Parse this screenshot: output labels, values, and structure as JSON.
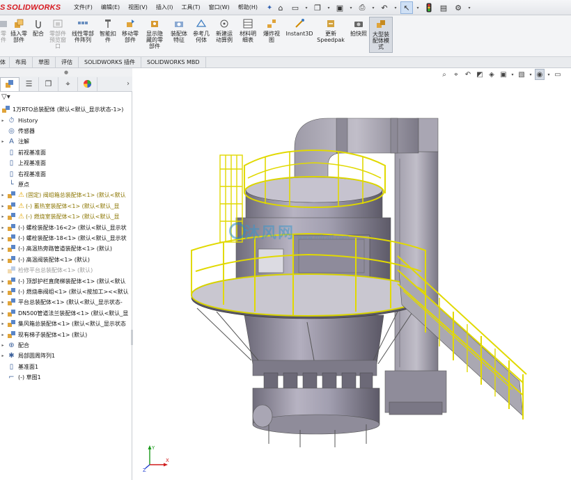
{
  "app": {
    "logo_text": "SOLIDWORKS",
    "menus": [
      "文件(F)",
      "编辑(E)",
      "视图(V)",
      "插入(I)",
      "工具(T)",
      "窗口(W)",
      "帮助(H)"
    ]
  },
  "ribbon": {
    "buttons": [
      {
        "label": "零\n件",
        "dim": true
      },
      {
        "label": "插入零\n部件"
      },
      {
        "label": "配合"
      },
      {
        "label": "零部件\n预览窗\n口",
        "dim": true
      },
      {
        "label": "线性零部\n件阵列"
      },
      {
        "label": "智能扣\n件"
      },
      {
        "label": "移动零\n部件"
      },
      {
        "label": "显示隐\n藏的零\n部件"
      },
      {
        "label": "装配体\n特征"
      },
      {
        "label": "参考几\n何体"
      },
      {
        "label": "新建运\n动算例"
      },
      {
        "label": "材料明\n细表"
      },
      {
        "label": "爆炸视\n图"
      },
      {
        "label": "Instant3D"
      },
      {
        "label": "更新\nSpeedpak"
      },
      {
        "label": "拍快照"
      },
      {
        "label": "大型装\n配体模\n式",
        "active": true
      }
    ]
  },
  "command_tabs": [
    "体",
    "布局",
    "草图",
    "评估",
    "SOLIDWORKS 插件",
    "SOLIDWORKS MBD"
  ],
  "feature_tree": {
    "root": "1万RTO总装配体  (默认<默认_显示状态-1>)",
    "items": [
      {
        "label": "History",
        "icon": "history-icon",
        "toggle": true
      },
      {
        "label": "传感器",
        "icon": "sensor-icon",
        "toggle": false
      },
      {
        "label": "注解",
        "icon": "annotation-icon",
        "toggle": true
      },
      {
        "label": "前视基准面",
        "icon": "plane-icon",
        "toggle": false
      },
      {
        "label": "上视基准面",
        "icon": "plane-icon",
        "toggle": false
      },
      {
        "label": "右视基准面",
        "icon": "plane-icon",
        "toggle": false
      },
      {
        "label": "原点",
        "icon": "origin-icon",
        "toggle": false
      },
      {
        "label": "(固定) 阀组箱总装配体<1> (默认<默认",
        "icon": "subassembly-warning-icon",
        "toggle": true,
        "warn": true
      },
      {
        "label": "(-) 蓄热室装配体<1> (默认<默认_显",
        "icon": "subassembly-warning-icon",
        "toggle": true,
        "warn": true
      },
      {
        "label": "(-) 燃烧室装配体<1> (默认<默认_显",
        "icon": "subassembly-warning-icon",
        "toggle": true,
        "warn": true
      },
      {
        "label": "(-) 螺栓装配体-16<2> (默认<默认_显示状",
        "icon": "subassembly-icon",
        "toggle": true
      },
      {
        "label": "(-) 螺栓装配体-18<1> (默认<默认_显示状",
        "icon": "subassembly-icon",
        "toggle": true
      },
      {
        "label": "(-) 高温热旁路管道装配体<1> (默认)",
        "icon": "subassembly-icon",
        "toggle": true
      },
      {
        "label": "(-) 高温阀装配体<1> (默认)",
        "icon": "subassembly-icon",
        "toggle": true
      },
      {
        "label": "检修平台总装配体<1> (默认)",
        "icon": "subassembly-suppressed-icon",
        "toggle": false,
        "gray": true
      },
      {
        "label": "(-) 顶部护栏直爬梯装配体<1> (默认<默认",
        "icon": "subassembly-icon",
        "toggle": true
      },
      {
        "label": "(-) 燃烧串阀组<1> (默认<按加工><<默认",
        "icon": "subassembly-icon",
        "toggle": true
      },
      {
        "label": "平台总装配体<1> (默认<默认_显示状态-",
        "icon": "subassembly-icon",
        "toggle": true
      },
      {
        "label": "DN500管道法兰装配体<1> (默认<默认_显",
        "icon": "subassembly-icon",
        "toggle": true
      },
      {
        "label": "集风箱总装配体<1> (默认<默认_显示状态",
        "icon": "subassembly-icon",
        "toggle": true
      },
      {
        "label": "现有梯子装配体<1> (默认)",
        "icon": "subassembly-icon",
        "toggle": true
      },
      {
        "label": "配合",
        "icon": "mates-icon",
        "toggle": true
      },
      {
        "label": "局部圆周阵列1",
        "icon": "circular-pattern-icon",
        "toggle": true
      },
      {
        "label": "基准面1",
        "icon": "plane-icon",
        "toggle": false
      },
      {
        "label": "(-) 草图1",
        "icon": "sketch-icon",
        "toggle": false
      }
    ]
  },
  "viewport": {
    "watermark_text": "沐风网",
    "watermark_url": "www.mfcad.com",
    "triad_labels": {
      "x": "X",
      "y": "Y",
      "z": "Z"
    }
  },
  "colors": {
    "accent_red": "#d71920",
    "railing_yellow": "#e8e000",
    "body_gray": "#8d8a98",
    "duct_gray": "#9d9aa5"
  }
}
